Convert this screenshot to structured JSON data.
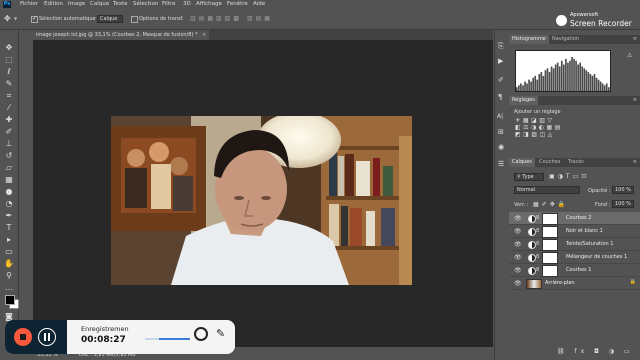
{
  "menu": [
    "Fichier",
    "Edition",
    "Image",
    "Calque",
    "Texte",
    "Sélection",
    "Filtre",
    "3D",
    "Affichage",
    "Fenêtre",
    "Aide"
  ],
  "options": {
    "auto_select_label": "Sélection automatique :",
    "auto_select_value": "Calque",
    "transform_label": "Options de transf."
  },
  "watermark": {
    "line1": "Apowersoft",
    "line2": "Screen Recorder"
  },
  "document": {
    "tab_title": "image joseph lol.jpg @ 33,1% (Courbes 2, Masque de fusion/8) *",
    "zoom": "33,33 %",
    "doc_info": "Doc : 5,93 Mo/5,93 Mo"
  },
  "panels": {
    "histogram_tabs": [
      "Histogramme",
      "Navigation"
    ],
    "adjustments_title": "Réglages",
    "adjustments_hint": "Ajouter un réglage",
    "layers_tabs": [
      "Calques",
      "Couches",
      "Tracés"
    ],
    "filter_type": "Type",
    "blend_mode": "Normal",
    "opacity_label": "Opacité :",
    "opacity_value": "100 %",
    "lock_label": "Verr. :",
    "fill_label": "Fond :",
    "fill_value": "100 %"
  },
  "layers": [
    {
      "name": "Courbes 2",
      "selected": true
    },
    {
      "name": "Noir et blanc 1",
      "selected": false
    },
    {
      "name": "Teinte/Saturation 1",
      "selected": false
    },
    {
      "name": "Mélangeur de couches 1",
      "selected": false
    },
    {
      "name": "Courbes 1",
      "selected": false
    },
    {
      "name": "Arrière-plan",
      "selected": false
    }
  ],
  "recorder": {
    "status": "Enregistremen",
    "time": "00:08:27"
  },
  "histogram_bars": [
    2,
    3,
    4,
    3,
    5,
    4,
    6,
    5,
    7,
    8,
    6,
    9,
    10,
    8,
    11,
    12,
    10,
    13,
    12,
    14,
    15,
    13,
    16,
    14,
    17,
    15,
    16,
    18,
    17,
    16,
    14,
    15,
    13,
    12,
    11,
    10,
    9,
    8,
    9,
    7,
    6,
    5,
    4,
    3,
    4,
    2
  ],
  "colors": {
    "accent": "#f7593a",
    "panel": "#535353",
    "canvas": "#282828"
  }
}
